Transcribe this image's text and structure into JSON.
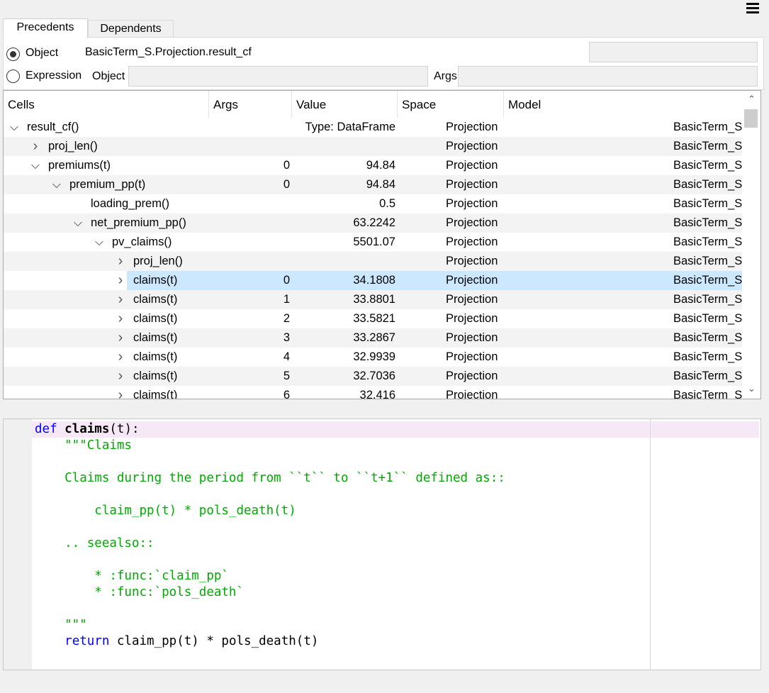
{
  "tabs": [
    {
      "label": "Precedents",
      "active": true
    },
    {
      "label": "Dependents",
      "active": false
    }
  ],
  "mode": {
    "object_label": "Object",
    "object_value": "BasicTerm_S.Projection.result_cf",
    "expression_label": "Expression",
    "expr_object_label": "Object",
    "expr_args_label": "Args",
    "selected": "Object"
  },
  "columns": [
    "Cells",
    "Args",
    "Value",
    "Space",
    "Model"
  ],
  "rows": [
    {
      "level": 0,
      "expander": "down",
      "name": "result_cf()",
      "args": "",
      "value": "Type: DataFrame",
      "space": "Projection",
      "model": "BasicTerm_S"
    },
    {
      "level": 1,
      "expander": "right",
      "name": "proj_len()",
      "args": "",
      "value": "",
      "space": "Projection",
      "model": "BasicTerm_S"
    },
    {
      "level": 1,
      "expander": "down",
      "name": "premiums(t)",
      "args": "0",
      "value": "94.84",
      "space": "Projection",
      "model": "BasicTerm_S"
    },
    {
      "level": 2,
      "expander": "down",
      "name": "premium_pp(t)",
      "args": "0",
      "value": "94.84",
      "space": "Projection",
      "model": "BasicTerm_S"
    },
    {
      "level": 3,
      "expander": "none",
      "name": "loading_prem()",
      "args": "",
      "value": "0.5",
      "space": "Projection",
      "model": "BasicTerm_S"
    },
    {
      "level": 3,
      "expander": "down",
      "name": "net_premium_pp()",
      "args": "",
      "value": "63.2242",
      "space": "Projection",
      "model": "BasicTerm_S"
    },
    {
      "level": 4,
      "expander": "down",
      "name": "pv_claims()",
      "args": "",
      "value": "5501.07",
      "space": "Projection",
      "model": "BasicTerm_S"
    },
    {
      "level": 5,
      "expander": "right",
      "name": "proj_len()",
      "args": "",
      "value": "",
      "space": "Projection",
      "model": "BasicTerm_S"
    },
    {
      "level": 5,
      "expander": "right",
      "name": "claims(t)",
      "args": "0",
      "value": "34.1808",
      "space": "Projection",
      "model": "BasicTerm_S",
      "selected": true
    },
    {
      "level": 5,
      "expander": "right",
      "name": "claims(t)",
      "args": "1",
      "value": "33.8801",
      "space": "Projection",
      "model": "BasicTerm_S"
    },
    {
      "level": 5,
      "expander": "right",
      "name": "claims(t)",
      "args": "2",
      "value": "33.5821",
      "space": "Projection",
      "model": "BasicTerm_S"
    },
    {
      "level": 5,
      "expander": "right",
      "name": "claims(t)",
      "args": "3",
      "value": "33.2867",
      "space": "Projection",
      "model": "BasicTerm_S"
    },
    {
      "level": 5,
      "expander": "right",
      "name": "claims(t)",
      "args": "4",
      "value": "32.9939",
      "space": "Projection",
      "model": "BasicTerm_S"
    },
    {
      "level": 5,
      "expander": "right",
      "name": "claims(t)",
      "args": "5",
      "value": "32.7036",
      "space": "Projection",
      "model": "BasicTerm_S"
    },
    {
      "level": 5,
      "expander": "right",
      "name": "claims(t)",
      "args": "6",
      "value": "32.416",
      "space": "Projection",
      "model": "BasicTerm_S"
    }
  ],
  "code": {
    "lines": [
      [
        {
          "t": "def",
          "c": "kw"
        },
        {
          "t": " "
        },
        {
          "t": "claims",
          "c": "fn"
        },
        {
          "t": "(t):"
        }
      ],
      [
        {
          "t": "    \"\"\"Claims",
          "c": "str"
        }
      ],
      [
        {
          "t": ""
        }
      ],
      [
        {
          "t": "    Claims during the period from ``t`` to ``t+1`` defined as::",
          "c": "str"
        }
      ],
      [
        {
          "t": ""
        }
      ],
      [
        {
          "t": "        claim_pp(t) * pols_death(t)",
          "c": "str"
        }
      ],
      [
        {
          "t": ""
        }
      ],
      [
        {
          "t": "    .. seealso::",
          "c": "str"
        }
      ],
      [
        {
          "t": ""
        }
      ],
      [
        {
          "t": "        * :func:`claim_pp`",
          "c": "str"
        }
      ],
      [
        {
          "t": "        * :func:`pols_death`",
          "c": "str"
        }
      ],
      [
        {
          "t": ""
        }
      ],
      [
        {
          "t": "    \"\"\"",
          "c": "str"
        }
      ],
      [
        {
          "t": "    "
        },
        {
          "t": "return",
          "c": "kw"
        },
        {
          "t": " claim_pp(t) * pols_death(t)"
        }
      ]
    ]
  },
  "colors": {
    "selection": "#cce8ff",
    "keyword": "#0000ff",
    "docstring": "#00aa00",
    "current_line": "#f6e8f6"
  }
}
